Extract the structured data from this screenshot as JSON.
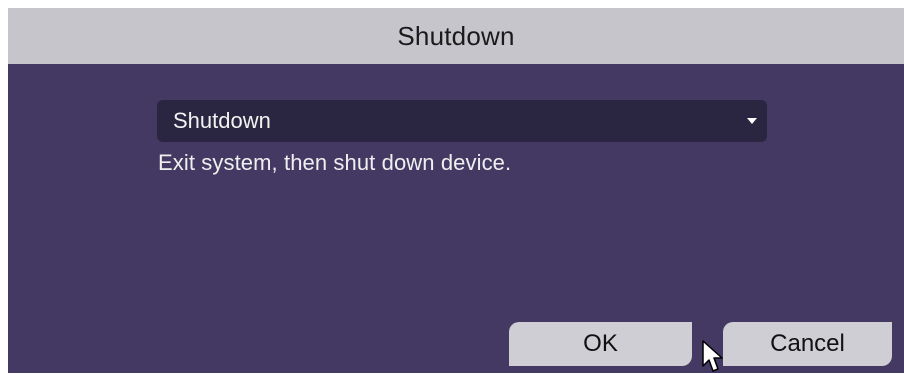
{
  "dialog": {
    "title": "Shutdown"
  },
  "shutdown_mode": {
    "selected": "Shutdown",
    "description": "Exit system, then shut down device."
  },
  "buttons": {
    "ok_label": "OK",
    "cancel_label": "Cancel"
  },
  "icons": {
    "dropdown": "chevron-down-icon",
    "cursor": "mouse-pointer-icon"
  },
  "colors": {
    "title_bar": "#c6c5cc",
    "panel_background": "#433962",
    "select_background": "#2a2540",
    "button_background": "#cfced4"
  }
}
